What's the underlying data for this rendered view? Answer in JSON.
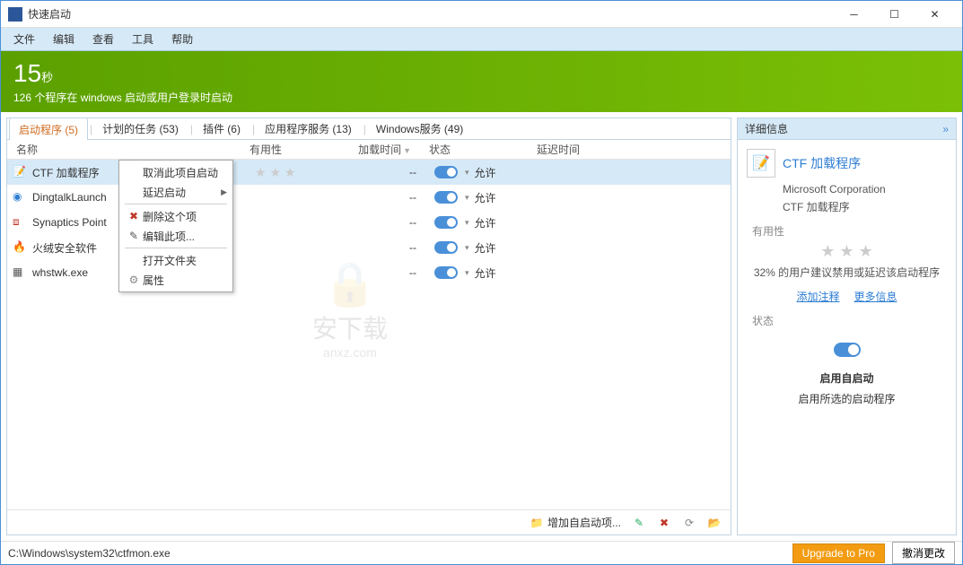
{
  "window": {
    "title": "快速启动"
  },
  "menus": [
    "文件",
    "编辑",
    "查看",
    "工具",
    "帮助"
  ],
  "banner": {
    "number": "15",
    "unit": "秒",
    "subtitle": "126 个程序在 windows 启动或用户登录时启动"
  },
  "tabs": [
    {
      "label": "启动程序 (5)",
      "active": true
    },
    {
      "label": "计划的任务 (53)"
    },
    {
      "label": "插件 (6)"
    },
    {
      "label": "应用程序服务 (13)"
    },
    {
      "label": "Windows服务 (49)"
    }
  ],
  "columns": {
    "name": "名称",
    "usability": "有用性",
    "loadtime": "加载时间",
    "status": "状态",
    "delay": "延迟时间"
  },
  "rows": [
    {
      "name": "CTF 加载程序",
      "icon": "doc",
      "stars": "★ ★ ★",
      "loadtime": "--",
      "status": "允许",
      "selected": true
    },
    {
      "name": "DingtalkLaunch",
      "icon": "globe",
      "loadtime": "--",
      "status": "允许"
    },
    {
      "name": "Synaptics Point",
      "icon": "chip",
      "loadtime": "--",
      "status": "允许"
    },
    {
      "name": "火绒安全软件",
      "icon": "flame",
      "loadtime": "--",
      "status": "允许"
    },
    {
      "name": "whstwk.exe",
      "icon": "app",
      "loadtime": "--",
      "status": "允许"
    }
  ],
  "context_menu": [
    {
      "label": "取消此项自启动",
      "icon": ""
    },
    {
      "label": "延迟启动",
      "icon": "",
      "submenu": true
    },
    {
      "sep": true
    },
    {
      "label": "删除这个项",
      "icon": "✖",
      "iconColor": "#c0392b"
    },
    {
      "label": "编辑此项...",
      "icon": "✎",
      "iconColor": "#555"
    },
    {
      "sep": true
    },
    {
      "label": "打开文件夹",
      "icon": ""
    },
    {
      "label": "属性",
      "icon": "⚙",
      "iconColor": "#888"
    }
  ],
  "footer": {
    "add": "增加自启动项...",
    "icons": [
      "✎",
      "✖",
      "🗑",
      "📁"
    ]
  },
  "details": {
    "panel_title": "详细信息",
    "name": "CTF 加载程序",
    "company": "Microsoft Corporation",
    "description": "CTF 加载程序",
    "usability_label": "有用性",
    "rating_text": "32% 的用户建议禁用或延迟该启动程序",
    "link_note": "添加注释",
    "link_more": "更多信息",
    "status_label": "状态",
    "status_title": "启用自启动",
    "status_desc": "启用所选的启动程序"
  },
  "statusbar": {
    "path": "C:\\Windows\\system32\\ctfmon.exe",
    "upgrade": "Upgrade to Pro",
    "cancel": "撤消更改"
  },
  "watermark": {
    "main": "安下载",
    "sub": "anxz.com"
  }
}
